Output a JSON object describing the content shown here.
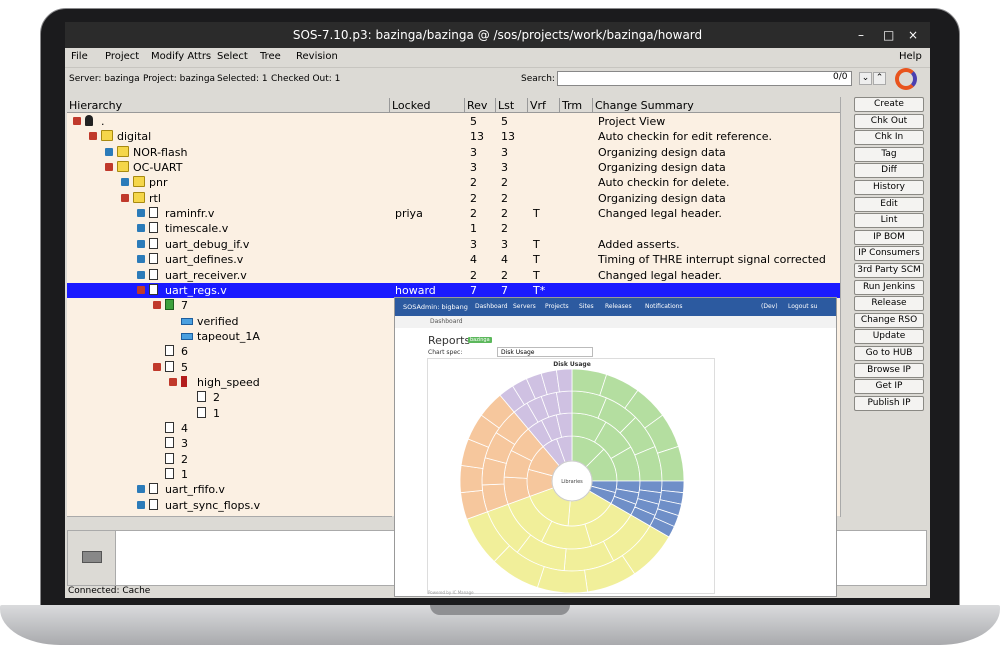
{
  "window": {
    "title": "SOS-7.10.p3: bazinga/bazinga @ /sos/projects/work/bazinga/howard",
    "controls": [
      "–",
      "□",
      "×"
    ]
  },
  "menu": [
    "File",
    "Project",
    "Modify Attrs",
    "Select",
    "Tree",
    "Revision"
  ],
  "help": "Help",
  "status": {
    "server": "Server: bazinga",
    "project": "Project: bazinga",
    "selected": "Selected: 1",
    "checked_out": "Checked Out: 1"
  },
  "search": {
    "label": "Search:",
    "value": "",
    "count": "0/0",
    "up": "⌄",
    "down": "⌃"
  },
  "columns": [
    "Hierarchy",
    "Locked",
    "Rev",
    "Lst",
    "Vrf",
    "Trm",
    "Change Summary"
  ],
  "rows": [
    {
      "name": ".",
      "locked": "",
      "rev": "5",
      "lst": "5",
      "vrf": "",
      "trm": "",
      "summary": "Project View"
    },
    {
      "name": "digital",
      "locked": "",
      "rev": "13",
      "lst": "13",
      "vrf": "",
      "trm": "",
      "summary": "Auto checkin for edit reference."
    },
    {
      "name": "NOR-flash",
      "locked": "",
      "rev": "3",
      "lst": "3",
      "vrf": "",
      "trm": "",
      "summary": "Organizing design data"
    },
    {
      "name": "OC-UART",
      "locked": "",
      "rev": "3",
      "lst": "3",
      "vrf": "",
      "trm": "",
      "summary": "Organizing design data"
    },
    {
      "name": "pnr",
      "locked": "",
      "rev": "2",
      "lst": "2",
      "vrf": "",
      "trm": "",
      "summary": "Auto checkin for delete."
    },
    {
      "name": "rtl",
      "locked": "",
      "rev": "2",
      "lst": "2",
      "vrf": "",
      "trm": "",
      "summary": "Organizing design data"
    },
    {
      "name": "raminfr.v",
      "locked": "priya",
      "rev": "2",
      "lst": "2",
      "vrf": "T",
      "trm": "",
      "summary": "Changed legal header."
    },
    {
      "name": "timescale.v",
      "locked": "",
      "rev": "1",
      "lst": "2",
      "vrf": "",
      "trm": "",
      "summary": ""
    },
    {
      "name": "uart_debug_if.v",
      "locked": "",
      "rev": "3",
      "lst": "3",
      "vrf": "T",
      "trm": "",
      "summary": "Added asserts."
    },
    {
      "name": "uart_defines.v",
      "locked": "",
      "rev": "4",
      "lst": "4",
      "vrf": "T",
      "trm": "",
      "summary": "Timing of THRE interrupt signal corrected"
    },
    {
      "name": "uart_receiver.v",
      "locked": "",
      "rev": "2",
      "lst": "2",
      "vrf": "T",
      "trm": "",
      "summary": "Changed legal header."
    },
    {
      "name": "uart_regs.v",
      "locked": "howard",
      "rev": "7",
      "lst": "7",
      "vrf": "T*",
      "trm": "",
      "summary": ""
    },
    {
      "name": "7",
      "locked": "",
      "rev": "",
      "lst": "",
      "vrf": "",
      "trm": "",
      "summary": ""
    },
    {
      "name": "verified",
      "locked": "",
      "rev": "",
      "lst": "",
      "vrf": "",
      "trm": "",
      "summary": ""
    },
    {
      "name": "tapeout_1A",
      "locked": "",
      "rev": "",
      "lst": "",
      "vrf": "",
      "trm": "",
      "summary": ""
    },
    {
      "name": "6",
      "locked": "",
      "rev": "",
      "lst": "",
      "vrf": "",
      "trm": "",
      "summary": ""
    },
    {
      "name": "5",
      "locked": "",
      "rev": "",
      "lst": "",
      "vrf": "",
      "trm": "",
      "summary": ""
    },
    {
      "name": "high_speed",
      "locked": "",
      "rev": "",
      "lst": "",
      "vrf": "",
      "trm": "",
      "summary": ""
    },
    {
      "name": "2",
      "locked": "",
      "rev": "",
      "lst": "",
      "vrf": "",
      "trm": "",
      "summary": ""
    },
    {
      "name": "1",
      "locked": "",
      "rev": "",
      "lst": "",
      "vrf": "",
      "trm": "",
      "summary": ""
    },
    {
      "name": "4",
      "locked": "",
      "rev": "",
      "lst": "",
      "vrf": "",
      "trm": "",
      "summary": ""
    },
    {
      "name": "3",
      "locked": "",
      "rev": "",
      "lst": "",
      "vrf": "",
      "trm": "",
      "summary": ""
    },
    {
      "name": "2",
      "locked": "",
      "rev": "",
      "lst": "",
      "vrf": "",
      "trm": "",
      "summary": ""
    },
    {
      "name": "1",
      "locked": "",
      "rev": "",
      "lst": "",
      "vrf": "",
      "trm": "",
      "summary": ""
    },
    {
      "name": "uart_rfifo.v",
      "locked": "",
      "rev": "",
      "lst": "",
      "vrf": "",
      "trm": "",
      "summary": ""
    },
    {
      "name": "uart_sync_flops.v",
      "locked": "",
      "rev": "",
      "lst": "",
      "vrf": "",
      "trm": "",
      "summary": ""
    }
  ],
  "buttons": [
    "Create",
    "Chk Out",
    "Chk In",
    "Tag",
    "Diff",
    "History",
    "Edit",
    "Lint",
    "IP BOM",
    "IP Consumers",
    "3rd Party SCM",
    "Run Jenkins",
    "Release",
    "Change RSO",
    "Update",
    "Go to HUB",
    "Browse IP",
    "Get IP",
    "Publish IP"
  ],
  "footer": {
    "connected": "Connected: Cache"
  },
  "overlay": {
    "brand": "SOSAdmin: bigbang",
    "nav": [
      "Dashboard",
      "Servers",
      "Projects",
      "Sites",
      "Releases",
      "Notifications"
    ],
    "nav_right": [
      "(Dev)",
      "Logout su"
    ],
    "breadcrumb": "Dashboard",
    "title": "Reports",
    "badge": "bazinga",
    "spec_label": "Chart spec:",
    "spec_value": "Disk Usage",
    "chart_title": "Disk Usage",
    "center_label": "Libraries",
    "footer": "Powered by IC Manage"
  },
  "colors": {
    "tree_bg": "#fbf0e3",
    "selection": "#1a1aff",
    "titlebar": "#2b2b2b",
    "nav_blue": "#2c5aa0",
    "sun_purple": "#cfc1e2",
    "sun_green": "#b4dea0",
    "sun_blue": "#6f8fc8",
    "sun_yellow": "#f1ef9a",
    "sun_orange": "#f6c79d"
  }
}
